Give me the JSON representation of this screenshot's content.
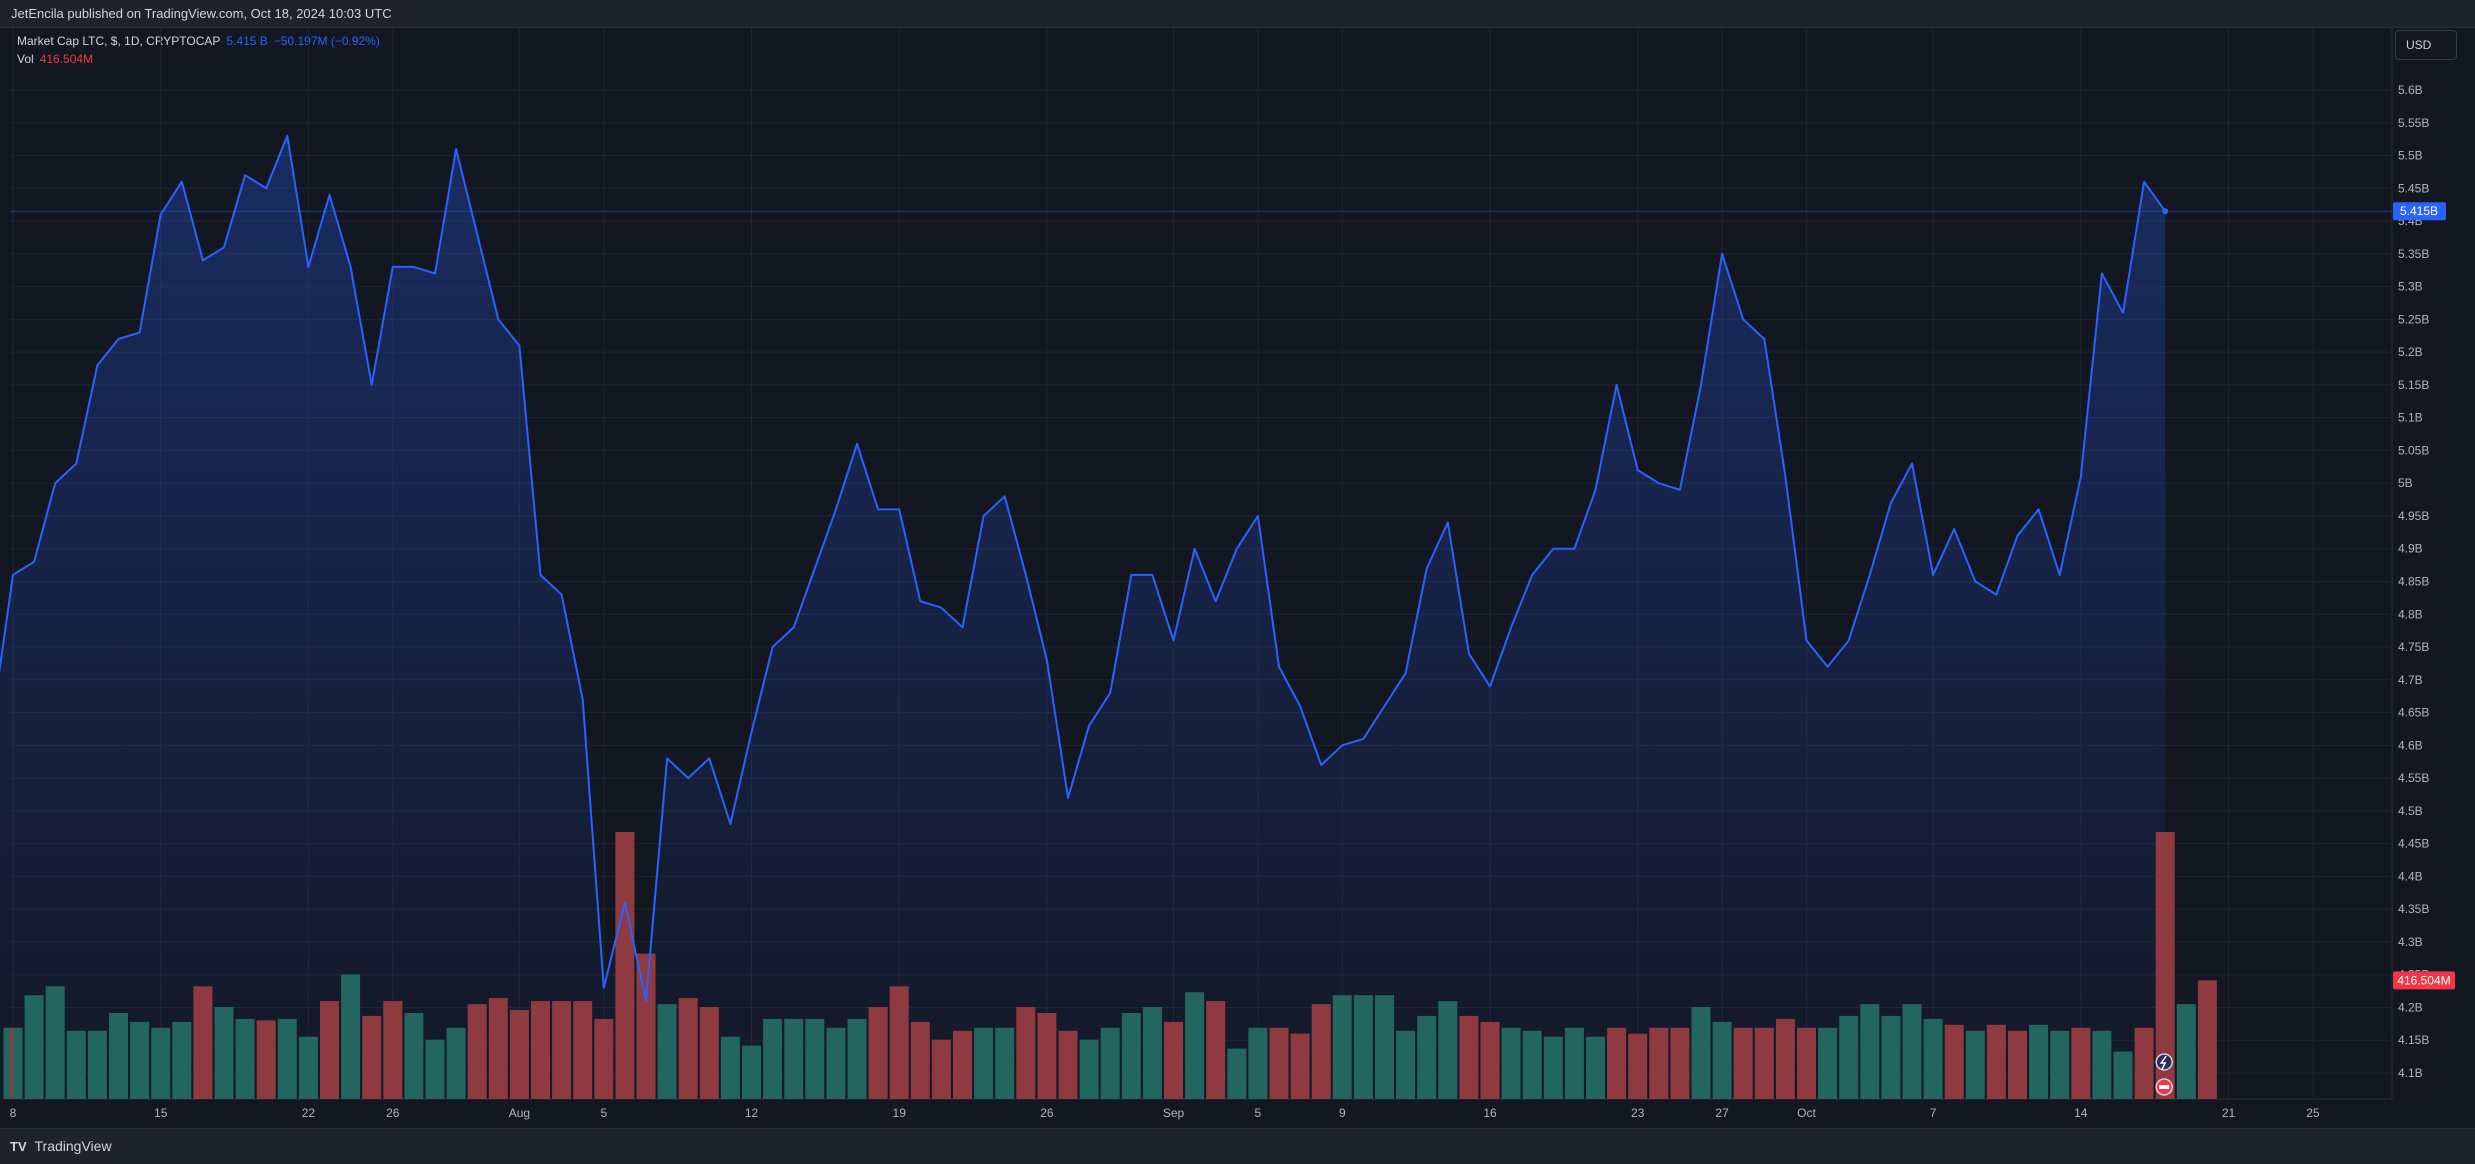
{
  "header": {
    "publisher": "JetEncila published on TradingView.com, Oct 18, 2024 10:03 UTC"
  },
  "legend": {
    "symbol": "Market Cap LTC, $, 1D, CRYPTOCAP",
    "value": "5.415 B",
    "change": "−50.197M (−0.92%)",
    "vol_label": "Vol",
    "vol_value": "416.504M"
  },
  "currency_button": "USD",
  "footer": {
    "logo": "TV",
    "brand": "TradingView"
  },
  "colors": {
    "line": "#2962ff",
    "up": "#22665f",
    "down": "#8e3a40",
    "bg": "#131722"
  },
  "chart_data": {
    "type": "area",
    "title": "Market Cap LTC, $, 1D, CRYPTOCAP",
    "ylabel": "USD",
    "ylim": [
      4.05,
      5.68
    ],
    "y_ticks": [
      "5.6B",
      "5.55B",
      "5.5B",
      "5.45B",
      "5.4B",
      "5.35B",
      "5.3B",
      "5.25B",
      "5.2B",
      "5.15B",
      "5.1B",
      "5.05B",
      "5B",
      "4.95B",
      "4.9B",
      "4.85B",
      "4.8B",
      "4.75B",
      "4.7B",
      "4.65B",
      "4.6B",
      "4.55B",
      "4.5B",
      "4.45B",
      "4.4B",
      "4.35B",
      "4.3B",
      "4.25B",
      "4.2B",
      "4.15B",
      "4.1B"
    ],
    "y_tick_values": [
      5.6,
      5.55,
      5.5,
      5.45,
      5.4,
      5.35,
      5.3,
      5.25,
      5.2,
      5.15,
      5.1,
      5.05,
      5.0,
      4.95,
      4.9,
      4.85,
      4.8,
      4.75,
      4.7,
      4.65,
      4.6,
      4.55,
      4.5,
      4.45,
      4.4,
      4.35,
      4.3,
      4.25,
      4.2,
      4.15,
      4.1
    ],
    "x_ticks": [
      {
        "label": "8",
        "day": 0
      },
      {
        "label": "15",
        "day": 7
      },
      {
        "label": "22",
        "day": 14
      },
      {
        "label": "26",
        "day": 18
      },
      {
        "label": "Aug",
        "day": 24
      },
      {
        "label": "5",
        "day": 28
      },
      {
        "label": "12",
        "day": 35
      },
      {
        "label": "19",
        "day": 42
      },
      {
        "label": "26",
        "day": 49
      },
      {
        "label": "Sep",
        "day": 55
      },
      {
        "label": "5",
        "day": 59
      },
      {
        "label": "9",
        "day": 63
      },
      {
        "label": "16",
        "day": 70
      },
      {
        "label": "23",
        "day": 77
      },
      {
        "label": "27",
        "day": 81
      },
      {
        "label": "Oct",
        "day": 85
      },
      {
        "label": "7",
        "day": 91
      },
      {
        "label": "14",
        "day": 98
      },
      {
        "label": "21",
        "day": 105
      },
      {
        "label": "25",
        "day": 109
      }
    ],
    "x_start_day": -0.75,
    "values": [
      4.86,
      4.88,
      5.0,
      5.03,
      5.18,
      5.22,
      5.23,
      5.41,
      5.46,
      5.34,
      5.36,
      5.47,
      5.45,
      5.53,
      5.33,
      5.44,
      5.33,
      5.15,
      5.33,
      5.33,
      5.32,
      5.51,
      5.38,
      5.25,
      5.21,
      4.86,
      4.83,
      4.67,
      4.23,
      4.36,
      4.21,
      4.58,
      4.55,
      4.58,
      4.48,
      4.62,
      4.75,
      4.78,
      4.87,
      4.96,
      5.06,
      4.96,
      4.96,
      4.82,
      4.81,
      4.78,
      4.95,
      4.98,
      4.86,
      4.73,
      4.52,
      4.63,
      4.68,
      4.86,
      4.86,
      4.76,
      4.9,
      4.82,
      4.9,
      4.95,
      4.72,
      4.66,
      4.57,
      4.6,
      4.61,
      4.66,
      4.71,
      4.87,
      4.94,
      4.74,
      4.69,
      4.78,
      4.86,
      4.9,
      4.9,
      4.99,
      5.15,
      5.02,
      5.0,
      4.99,
      5.15,
      5.35,
      5.25,
      5.22,
      5.01,
      4.76,
      4.72,
      4.76,
      4.86,
      4.97,
      5.03,
      4.86,
      4.93,
      4.85,
      4.83,
      4.92,
      4.96,
      4.86,
      5.01,
      5.32,
      5.26,
      5.46,
      5.415
    ],
    "first_value": 4.69,
    "last_value_label": "5.415B",
    "volume": {
      "label": "Vol",
      "last_label": "416.504M",
      "max": 900,
      "values": [
        240,
        350,
        380,
        230,
        230,
        290,
        260,
        240,
        260,
        380,
        310,
        270,
        265,
        270,
        210,
        330,
        420,
        280,
        330,
        290,
        200,
        240,
        320,
        340,
        300,
        330,
        330,
        330,
        270,
        900,
        490,
        320,
        340,
        310,
        210,
        180,
        270,
        270,
        270,
        240,
        270,
        310,
        380,
        260,
        200,
        230,
        240,
        240,
        310,
        290,
        230,
        200,
        240,
        290,
        310,
        260,
        360,
        330,
        170,
        240,
        240,
        220,
        320,
        350,
        350,
        350,
        230,
        280,
        330,
        280,
        260,
        240,
        230,
        210,
        240,
        210,
        240,
        220,
        240,
        240,
        310,
        260,
        240,
        240,
        270,
        240,
        240,
        280,
        320,
        280,
        320,
        270,
        250,
        230,
        250,
        230,
        250,
        230,
        240,
        230,
        160,
        240,
        900,
        320,
        400
      ],
      "up": [
        1,
        1,
        1,
        1,
        1,
        1,
        1,
        1,
        1,
        0,
        1,
        1,
        0,
        1,
        1,
        0,
        1,
        0,
        0,
        1,
        1,
        1,
        0,
        0,
        0,
        0,
        0,
        0,
        0,
        0,
        0,
        1,
        0,
        0,
        1,
        1,
        1,
        1,
        1,
        1,
        1,
        0,
        0,
        0,
        0,
        0,
        1,
        1,
        0,
        0,
        0,
        1,
        1,
        1,
        1,
        0,
        1,
        0,
        1,
        1,
        0,
        0,
        0,
        1,
        1,
        1,
        1,
        1,
        1,
        0,
        0,
        1,
        1,
        1,
        1,
        1,
        0,
        0,
        0,
        0,
        1,
        1,
        0,
        0,
        0,
        0,
        1,
        1,
        1,
        1,
        1,
        1,
        0,
        1,
        0,
        0,
        1,
        1,
        0,
        1,
        1,
        0,
        0,
        1,
        0
      ]
    }
  }
}
